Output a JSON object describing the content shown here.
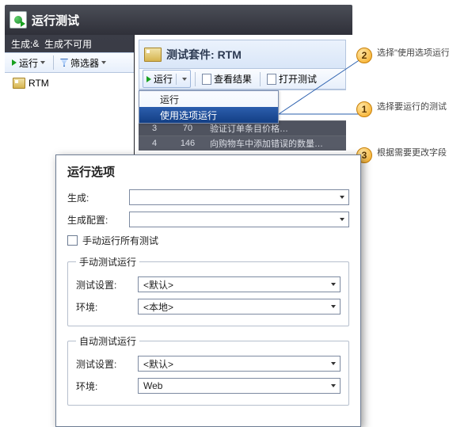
{
  "header": {
    "title": "运行测试"
  },
  "sidebar": {
    "build_label": "生成:",
    "build_value": "生成不可用",
    "run_btn": "运行",
    "filter_btn": "筛选器",
    "tree": [
      {
        "label": "RTM"
      }
    ]
  },
  "main": {
    "suite_prefix": "测试套件:",
    "suite_name": "RTM",
    "toolbar": {
      "run": "运行",
      "view_results": "查看结果",
      "open_test": "打开测试"
    },
    "run_menu": {
      "run": "运行",
      "run_with_options": "使用选项运行"
    },
    "grid": [
      {
        "n": "3",
        "id": "70",
        "title": "验证订单条目价格…"
      },
      {
        "n": "4",
        "id": "146",
        "title": "向购物车中添加错误的数量…"
      }
    ]
  },
  "callouts": {
    "c1": {
      "num": "1",
      "text": "选择要运行的测试"
    },
    "c2": {
      "num": "2",
      "text": "选择\"使用选项运行\""
    },
    "c3": {
      "num": "3",
      "text": "根据需要更改字段"
    }
  },
  "dialog": {
    "title": "运行选项",
    "build_label": "生成:",
    "build_config_label": "生成配置:",
    "manual_all_label": "手动运行所有测试",
    "manual_group": "手动测试运行",
    "auto_group": "自动测试运行",
    "settings_label": "测试设置:",
    "env_label": "环境:",
    "default_opt": "<默认>",
    "local_opt": "<本地>",
    "web_opt": "Web"
  }
}
